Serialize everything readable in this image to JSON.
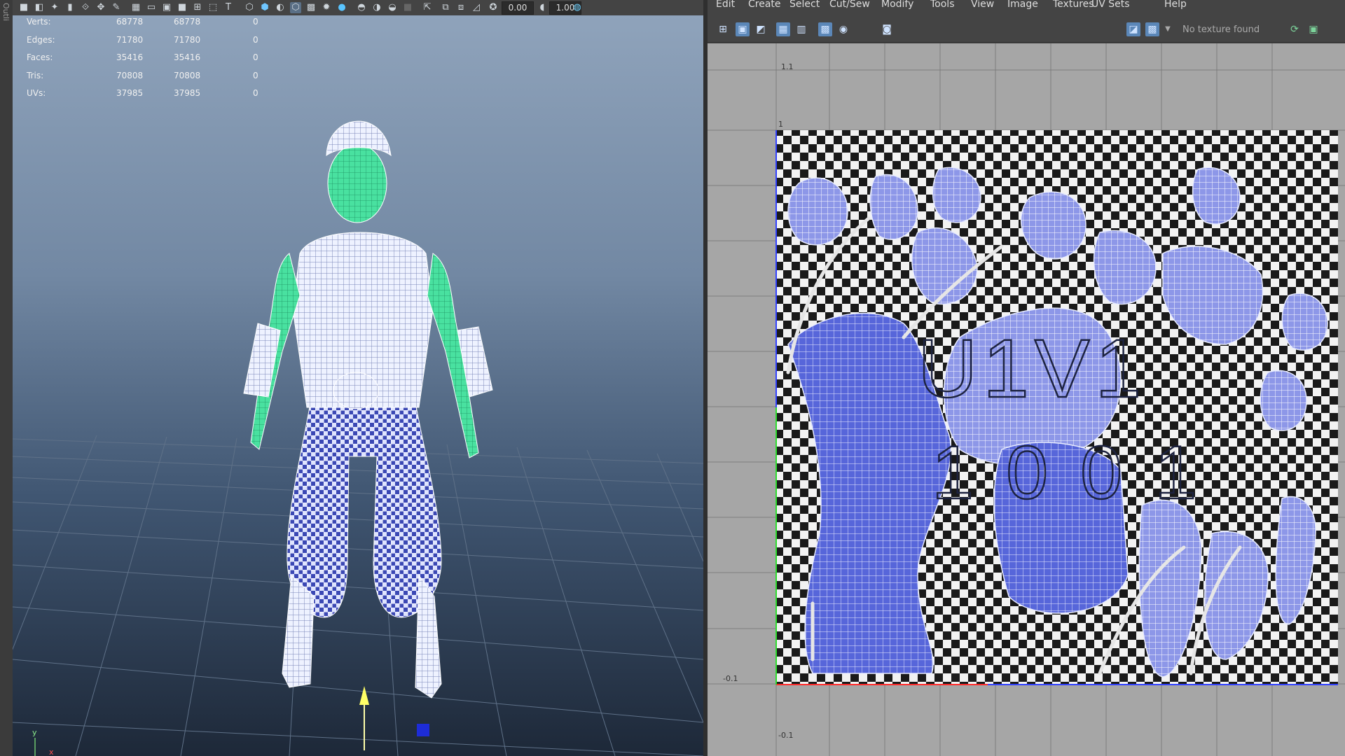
{
  "outliner": {
    "title": "Outli"
  },
  "viewport": {
    "toolbar": {
      "field_a": "0.00",
      "field_b": "1.00"
    },
    "hud": {
      "rows": [
        {
          "label": "Verts:",
          "v1": "68778",
          "v2": "68778",
          "v3": "0"
        },
        {
          "label": "Edges:",
          "v1": "71780",
          "v2": "71780",
          "v3": "0"
        },
        {
          "label": "Faces:",
          "v1": "35416",
          "v2": "35416",
          "v3": "0"
        },
        {
          "label": "Tris:",
          "v1": "70808",
          "v2": "70808",
          "v3": "0"
        },
        {
          "label": "UVs:",
          "v1": "37985",
          "v2": "37985",
          "v3": "0"
        }
      ]
    },
    "axis": {
      "y": "y",
      "x": "x"
    }
  },
  "uv_editor": {
    "menu": [
      "Edit",
      "Create",
      "Select",
      "Cut/Sew",
      "Modify",
      "Tools",
      "View",
      "Image",
      "Textures",
      "UV Sets",
      "Help"
    ],
    "texture_status": "No texture found",
    "grid_labels": {
      "top": "1.1",
      "one": "1",
      "left_neg": "-0.1",
      "bottom_neg": "-0.1"
    },
    "tile_label": {
      "line1": "U1V1",
      "line2": "1001"
    },
    "colors": {
      "uv_shell_fill": "#4d5ad8",
      "shell_edge": "#e8ecff",
      "u_axis": "#ff2a2a",
      "v_axis": "#2ddc2d",
      "selection": "#40f0a8"
    }
  }
}
